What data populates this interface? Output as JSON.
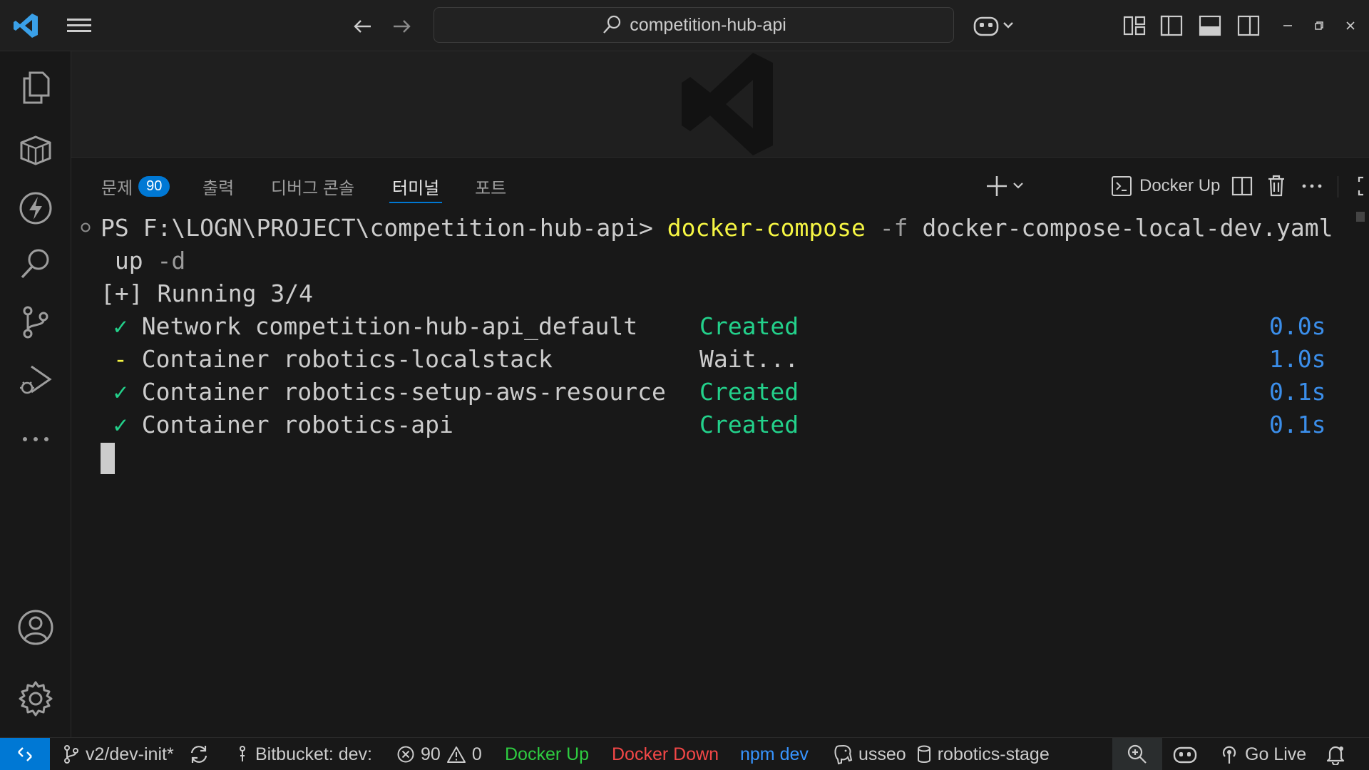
{
  "titlebar": {
    "search_label": "competition-hub-api"
  },
  "panel": {
    "tabs": [
      {
        "label": "문제",
        "badge": "90"
      },
      {
        "label": "출력"
      },
      {
        "label": "디버그 콘솔"
      },
      {
        "label": "터미널",
        "active": true
      },
      {
        "label": "포트"
      }
    ],
    "terminal_profile": "Docker Up"
  },
  "terminal": {
    "prompt": "PS F:\\LOGN\\PROJECT\\competition-hub-api> ",
    "command": "docker-compose",
    "flag_f": " -f ",
    "file": "docker-compose-local-dev.yaml",
    "cont_up": " up",
    "cont_d": " -d",
    "running": "[+] Running 3/4",
    "rows": [
      {
        "mark": "✓",
        "text": "Network competition-hub-api_default",
        "status": "Created",
        "time": "0.0s"
      },
      {
        "mark": "-",
        "text": "Container robotics-localstack",
        "status": "Wait...",
        "time": "1.0s"
      },
      {
        "mark": "✓",
        "text": "Container robotics-setup-aws-resource",
        "status": "Created",
        "time": "0.1s"
      },
      {
        "mark": "✓",
        "text": "Container robotics-api",
        "status": "Created",
        "time": "0.1s"
      }
    ]
  },
  "statusbar": {
    "branch": "v2/dev-init*",
    "bitbucket": "Bitbucket: dev:",
    "errors": "90",
    "warnings": "0",
    "docker_up": "Docker Up",
    "docker_down": "Docker Down",
    "npm_dev": "npm dev",
    "db_user": "usseo",
    "db_conn": "robotics-stage",
    "go_live": "Go Live"
  },
  "colors": {
    "accent": "#0078d4",
    "docker_up": "#2ecc40",
    "docker_down": "#f44747",
    "npm_dev": "#3794ff",
    "term_yellow": "#f5f543",
    "term_green": "#23d18b",
    "term_blue": "#3b8eea"
  }
}
